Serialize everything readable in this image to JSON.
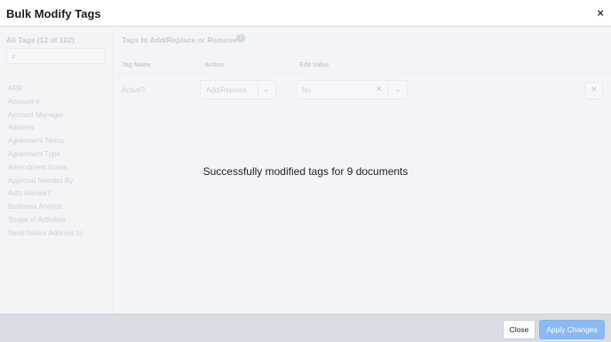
{
  "window": {
    "title": "Bulk Modify Tags",
    "close_icon": "×"
  },
  "sidebar": {
    "header": "All Tags (12 of 102)",
    "search_value": "#",
    "items": [
      "ARR",
      "Account #",
      "Account Manager",
      "Address",
      "Agreement Terms",
      "Agreement Type",
      "Amendment Notes",
      "Approval Needed By",
      "Auto Renew?",
      "Business Analyst",
      "Scope of Activities",
      "Send Notice Address to:"
    ]
  },
  "main": {
    "header": "Tags to Add/Replace or Remove",
    "columns": {
      "tag_name": "Tag Name",
      "action": "Action",
      "edit_value": "Edit Value"
    },
    "row": {
      "tag_name": "Active?",
      "action": "Add/Replace",
      "value": "No"
    }
  },
  "message": "Successfully modified tags for 9 documents",
  "footer": {
    "close_label": "Close",
    "apply_label": "Apply Changes"
  },
  "colors": {
    "apply_button": "#8ab9f3",
    "footer_bg": "#d9dde3",
    "panel_bg": "#f3f4f7"
  }
}
